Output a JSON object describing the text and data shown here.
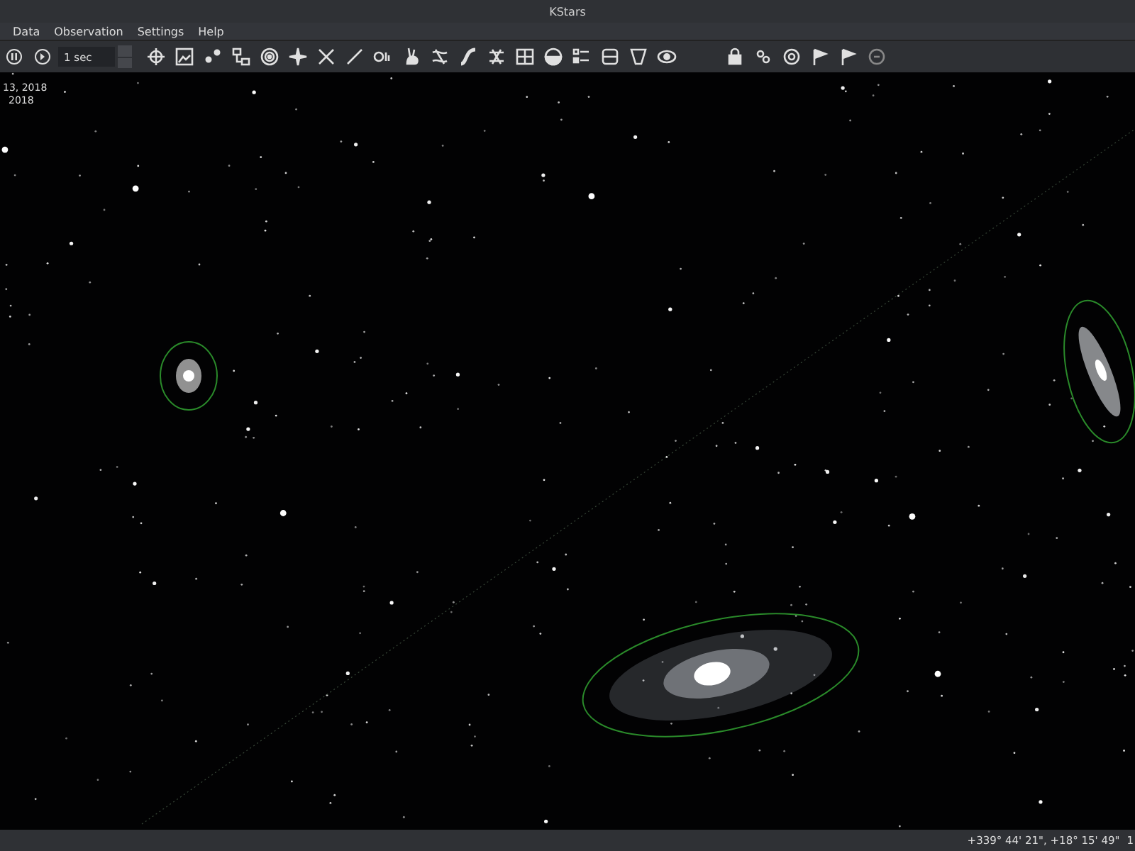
{
  "window": {
    "title": "KStars"
  },
  "menu": [
    "Data",
    "Observation",
    "Settings",
    "Help"
  ],
  "toolbar": {
    "time_step": "1 sec"
  },
  "sky": {
    "info_lines": [
      "13, 2018",
      "2018"
    ]
  },
  "status_bar": {
    "coordinates": "+339° 44' 21\", +18° 15' 49\"",
    "column_2": "1"
  }
}
